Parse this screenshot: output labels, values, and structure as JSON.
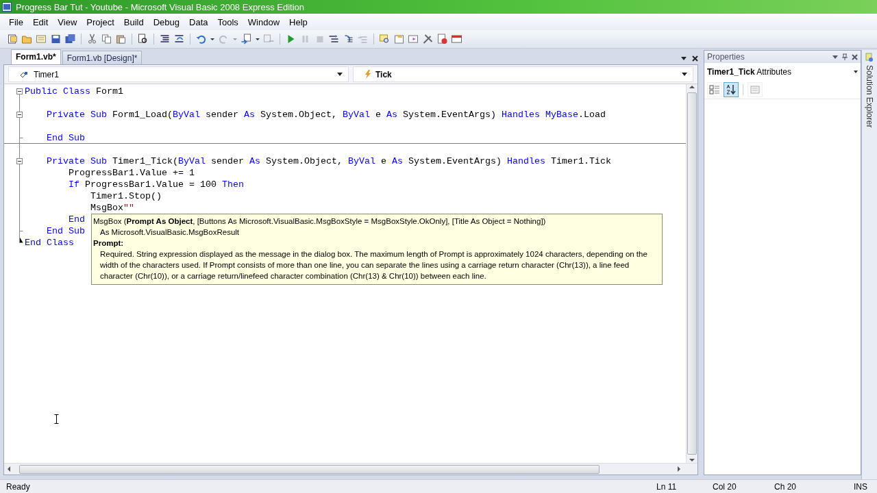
{
  "window": {
    "title": "Progress Bar Tut - Youtube - Microsoft Visual Basic 2008 Express Edition"
  },
  "menu": [
    "File",
    "Edit",
    "View",
    "Project",
    "Build",
    "Debug",
    "Data",
    "Tools",
    "Window",
    "Help"
  ],
  "document_tabs": [
    {
      "label": "Form1.vb*",
      "selected": true
    },
    {
      "label": "Form1.vb [Design]*",
      "selected": false
    }
  ],
  "editor": {
    "object_selector": "Timer1",
    "event_selector": "Tick",
    "lines": [
      {
        "kind": "block_start",
        "tokens": [
          {
            "kind": "kw",
            "text": "Public Class"
          },
          {
            "kind": "plain",
            "text": " Form1"
          }
        ]
      },
      {
        "kind": "block_inner"
      },
      {
        "kind": "block_start",
        "tokens": [
          {
            "kind": "kw",
            "text": "    Private Sub"
          },
          {
            "kind": "plain",
            "text": " Form1_Load("
          },
          {
            "kind": "kw",
            "text": "ByVal"
          },
          {
            "kind": "plain",
            "text": " sender "
          },
          {
            "kind": "kw",
            "text": "As"
          },
          {
            "kind": "plain",
            "text": " System.Object, "
          },
          {
            "kind": "kw",
            "text": "ByVal"
          },
          {
            "kind": "plain",
            "text": " e "
          },
          {
            "kind": "kw",
            "text": "As"
          },
          {
            "kind": "plain",
            "text": " System.EventArgs) "
          },
          {
            "kind": "kw",
            "text": "Handles"
          },
          {
            "kind": "kw",
            "text": " MyBase"
          },
          {
            "kind": "plain",
            "text": ".Load"
          }
        ]
      },
      {
        "kind": "block_inner"
      },
      {
        "kind": "block_end",
        "separator": true,
        "tokens": [
          {
            "kind": "kw",
            "text": "    End Sub"
          }
        ]
      },
      {
        "kind": "block_inner"
      },
      {
        "kind": "block_start",
        "tokens": [
          {
            "kind": "kw",
            "text": "    Private Sub"
          },
          {
            "kind": "plain",
            "text": " Timer1_Tick("
          },
          {
            "kind": "kw",
            "text": "ByVal"
          },
          {
            "kind": "plain",
            "text": " sender "
          },
          {
            "kind": "kw",
            "text": "As"
          },
          {
            "kind": "plain",
            "text": " System.Object, "
          },
          {
            "kind": "kw",
            "text": "ByVal"
          },
          {
            "kind": "plain",
            "text": " e "
          },
          {
            "kind": "kw",
            "text": "As"
          },
          {
            "kind": "plain",
            "text": " System.EventArgs) "
          },
          {
            "kind": "kw",
            "text": "Handles"
          },
          {
            "kind": "plain",
            "text": " Timer1.Tick"
          }
        ]
      },
      {
        "kind": "block_inner",
        "tokens": [
          {
            "kind": "plain",
            "text": "        ProgressBar1.Value += 1"
          }
        ]
      },
      {
        "kind": "block_inner",
        "tokens": [
          {
            "kind": "kw",
            "text": "        If"
          },
          {
            "kind": "plain",
            "text": " ProgressBar1.Value = 100 "
          },
          {
            "kind": "kw",
            "text": "Then"
          }
        ]
      },
      {
        "kind": "block_inner",
        "tokens": [
          {
            "kind": "plain",
            "text": "            Timer1.Stop()"
          }
        ]
      },
      {
        "kind": "block_inner",
        "tokens": [
          {
            "kind": "plain",
            "text": "            MsgBox"
          },
          {
            "kind": "str",
            "text": "\"\""
          }
        ]
      },
      {
        "kind": "block_inner",
        "tokens": [
          {
            "kind": "kw",
            "text": "        End"
          }
        ]
      },
      {
        "kind": "block_end",
        "tokens": [
          {
            "kind": "kw",
            "text": "    End Sub"
          }
        ]
      },
      {
        "kind": "block_last",
        "tokens": [
          {
            "kind": "kw",
            "text": "End Class"
          }
        ]
      }
    ],
    "tooltip": {
      "signature": "MsgBox (**Prompt As Object**, [Buttons As Microsoft.VisualBasic.MsgBoxStyle = MsgBoxStyle.OkOnly], [Title As Object = Nothing])",
      "returns": "As Microsoft.VisualBasic.MsgBoxResult",
      "parameter": "Prompt:",
      "description": "Required. String expression displayed as the message in the dialog box. The maximum length of Prompt is approximately 1024 characters, depending on the width of the characters used. If Prompt consists of more than one line, you can separate the lines using a carriage return character (Chr(13)), a line feed character (Chr(10)), or a carriage return/linefeed character combination (Chr(13) & Chr(10)) between each line."
    }
  },
  "properties": {
    "title": "Properties",
    "object_name": "Timer1_Tick",
    "object_type": "Attributes",
    "view_buttons": [
      {
        "kind": "categorized",
        "selected": false
      },
      {
        "kind": "alphabetical",
        "selected": true
      },
      {
        "kind": "pages",
        "selected": false
      }
    ]
  },
  "side_tab": "Solution Explorer",
  "status_bar": {
    "message": "Ready",
    "line": "Ln 11",
    "column": "Col 20",
    "char": "Ch 20",
    "mode": "INS"
  }
}
